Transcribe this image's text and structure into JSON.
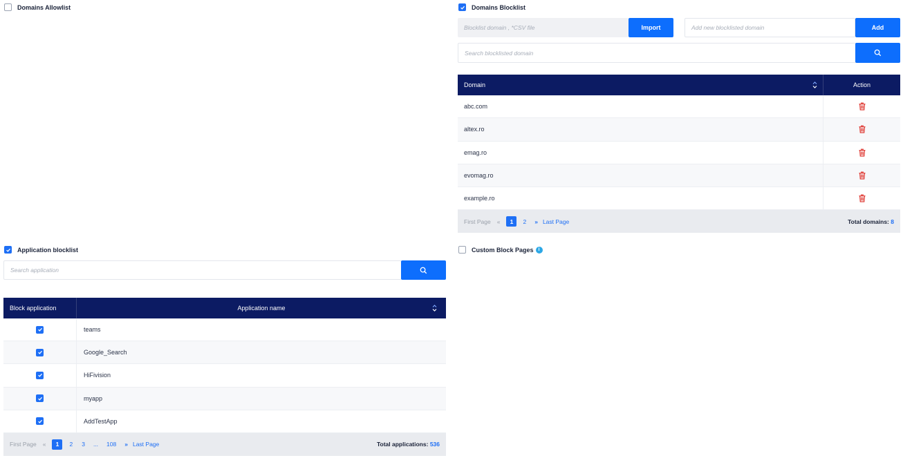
{
  "allowlist": {
    "label": "Domains Allowlist",
    "checked": false
  },
  "blocklist": {
    "label": "Domains Blocklist",
    "checked": true,
    "import_placeholder": "Blocklist domain , *CSV file",
    "import_label": "Import",
    "add_placeholder": "Add new blocklisted domain",
    "add_label": "Add",
    "search_placeholder": "Search blocklisted domain",
    "columns": {
      "domain": "Domain",
      "action": "Action"
    },
    "rows": [
      "abc.com",
      "altex.ro",
      "emag.ro",
      "evomag.ro",
      "example.ro"
    ],
    "pager": {
      "first": "First Page",
      "prev": "«",
      "pages": [
        "1",
        "2"
      ],
      "current": "1",
      "next": "»",
      "last": "Last Page",
      "total_label": "Total domains:",
      "total_value": "8"
    }
  },
  "custom_block_pages": {
    "label": "Custom Block Pages",
    "checked": false,
    "info_icon": "info-icon"
  },
  "appblock": {
    "label": "Application blocklist",
    "checked": true,
    "search_placeholder": "Search application",
    "columns": {
      "block": "Block application",
      "name": "Application name"
    },
    "rows": [
      {
        "name": "teams",
        "blocked": true
      },
      {
        "name": "Google_Search",
        "blocked": true
      },
      {
        "name": "HiFivision",
        "blocked": true
      },
      {
        "name": "myapp",
        "blocked": true
      },
      {
        "name": "AddTestApp",
        "blocked": true
      }
    ],
    "pager": {
      "first": "First Page",
      "prev": "«",
      "pages": [
        "1",
        "2",
        "3",
        "...",
        "108"
      ],
      "current": "1",
      "next": "»",
      "last": "Last Page",
      "total_label": "Total applications:",
      "total_value": "536"
    }
  },
  "colors": {
    "accent": "#0d6efd",
    "header": "#0c1b63",
    "delete": "#e0403a"
  }
}
